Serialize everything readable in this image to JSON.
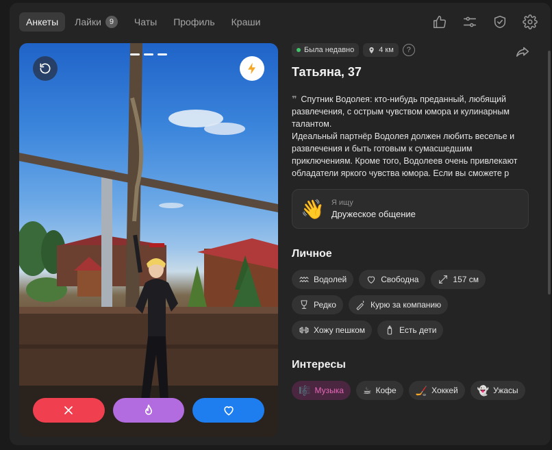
{
  "nav": {
    "tabs": [
      {
        "label": "Анкеты"
      },
      {
        "label": "Лайки",
        "badge": "9"
      },
      {
        "label": "Чаты"
      },
      {
        "label": "Профиль"
      },
      {
        "label": "Краши"
      }
    ],
    "icons": [
      "thumbs-up-icon",
      "sliders-icon",
      "shield-check-icon",
      "gear-icon"
    ]
  },
  "photo": {
    "actions": [
      "close-icon",
      "flame-icon",
      "heart-icon"
    ],
    "colors": {
      "dislike": "#f0404f",
      "super": "#b36be0",
      "like": "#1e7ef0"
    }
  },
  "profile": {
    "status": "Была недавно",
    "distance": "4 км",
    "help": "?",
    "name": "Татьяна, 37",
    "bio_line1": "Спутник Водолея: кто-нибудь преданный, любящий развлечения, с острым чувством юмора и кулинарным талантом.",
    "bio_line2": "Идеальный партнёр Водолея должен любить веселье и развлечения и быть готовым к сумасшедшим приключениям. Кроме того, Водолеев очень привлекают обладатели яркого чувства юмора. Если вы сможете р",
    "looking_label": "Я ищу",
    "looking_value": "Дружеское общение"
  },
  "personal": {
    "title": "Личное",
    "chips": [
      "Водолей",
      "Свободна",
      "157 см",
      "Редко",
      "Курю за компанию",
      "Хожу пешком",
      "Есть дети"
    ]
  },
  "interests": {
    "title": "Интересы",
    "chips": [
      "Музыка",
      "Кофе",
      "Хоккей",
      "Ужасы"
    ],
    "accent": "#e768b8"
  }
}
